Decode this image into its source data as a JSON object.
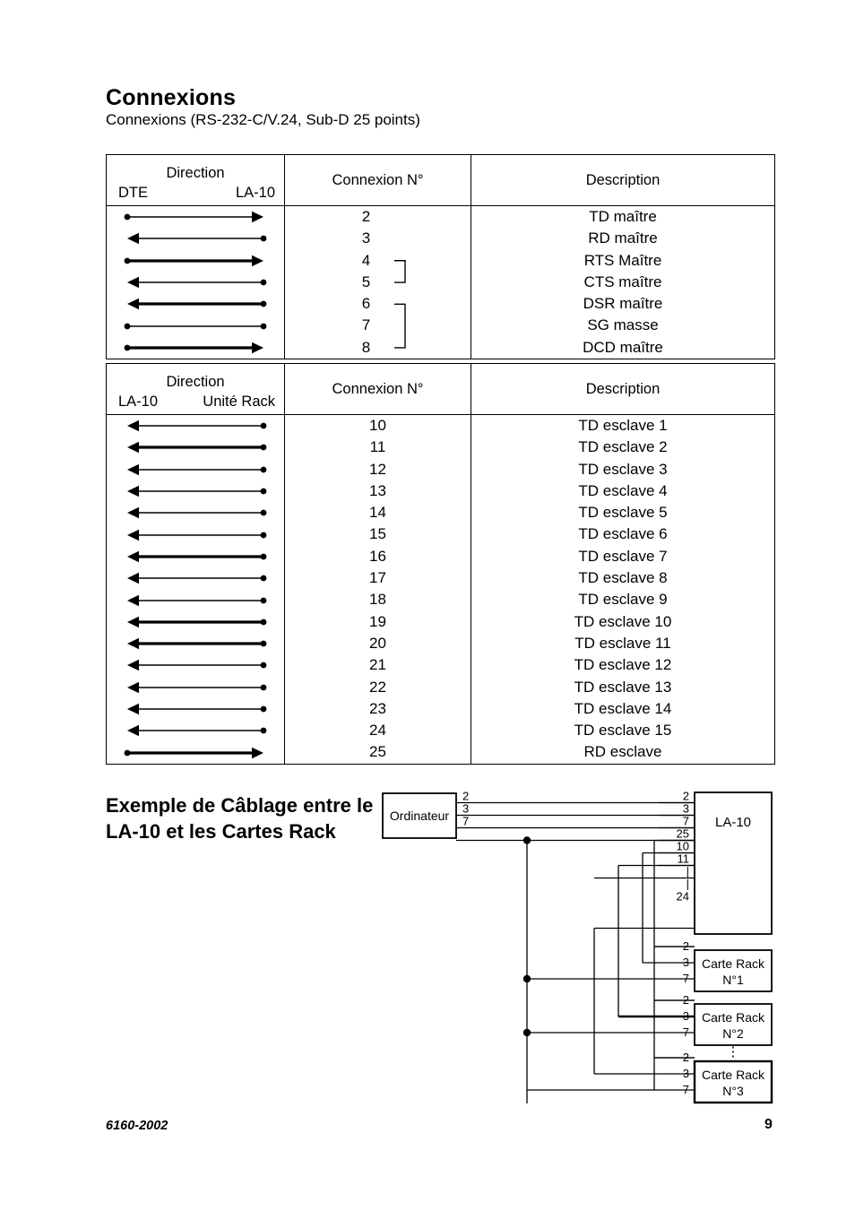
{
  "page": {
    "title": "Connexions",
    "subtitle": "Connexions (RS-232-C/V.24, Sub-D 25 points)"
  },
  "table_dte": {
    "header": {
      "direction": "Direction",
      "from": "DTE",
      "to": "LA-10",
      "connexion": "Connexion N°",
      "description": "Description"
    },
    "rows": [
      {
        "arrow": "right",
        "weight": "thin",
        "num": "2",
        "desc": "TD maître"
      },
      {
        "arrow": "left",
        "weight": "thin",
        "num": "3",
        "desc": "RD maître"
      },
      {
        "arrow": "right",
        "weight": "thick",
        "num": "4",
        "desc": "RTS Maître"
      },
      {
        "arrow": "left",
        "weight": "thin",
        "num": "5",
        "desc": "CTS maître"
      },
      {
        "arrow": "left",
        "weight": "thick",
        "num": "6",
        "desc": "DSR maître"
      },
      {
        "arrow": "none",
        "weight": "thin",
        "num": "7",
        "desc": "SG masse"
      },
      {
        "arrow": "right",
        "weight": "thick",
        "num": "8",
        "desc": "DCD maître"
      }
    ],
    "brackets": [
      {
        "from_row": 2,
        "to_row": 3
      },
      {
        "from_row": 4,
        "to_row": 6
      }
    ]
  },
  "table_rack": {
    "header": {
      "direction": "Direction",
      "from": "LA-10",
      "to": "Unité Rack",
      "connexion": "Connexion N°",
      "description": "Description"
    },
    "rows": [
      {
        "arrow": "left",
        "weight": "thin",
        "num": "10",
        "desc": "TD esclave 1"
      },
      {
        "arrow": "left",
        "weight": "thick",
        "num": "11",
        "desc": "TD esclave 2"
      },
      {
        "arrow": "left",
        "weight": "thin",
        "num": "12",
        "desc": "TD esclave 3"
      },
      {
        "arrow": "left",
        "weight": "thin",
        "num": "13",
        "desc": "TD esclave 4"
      },
      {
        "arrow": "left",
        "weight": "thin",
        "num": "14",
        "desc": "TD esclave 5"
      },
      {
        "arrow": "left",
        "weight": "thin",
        "num": "15",
        "desc": "TD esclave 6"
      },
      {
        "arrow": "left",
        "weight": "thick",
        "num": "16",
        "desc": "TD esclave 7"
      },
      {
        "arrow": "left",
        "weight": "thin",
        "num": "17",
        "desc": "TD esclave 8"
      },
      {
        "arrow": "left",
        "weight": "thin",
        "num": "18",
        "desc": "TD esclave 9"
      },
      {
        "arrow": "left",
        "weight": "thick",
        "num": "19",
        "desc": "TD esclave 10"
      },
      {
        "arrow": "left",
        "weight": "thick",
        "num": "20",
        "desc": "TD esclave 11"
      },
      {
        "arrow": "left",
        "weight": "thin",
        "num": "21",
        "desc": "TD esclave 12"
      },
      {
        "arrow": "left",
        "weight": "thin",
        "num": "22",
        "desc": "TD esclave 13"
      },
      {
        "arrow": "left",
        "weight": "thin",
        "num": "23",
        "desc": "TD esclave 14"
      },
      {
        "arrow": "left",
        "weight": "thin",
        "num": "24",
        "desc": "TD esclave 15"
      },
      {
        "arrow": "right",
        "weight": "thick",
        "num": "25",
        "desc": "RD esclave"
      }
    ]
  },
  "example": {
    "heading": "Exemple de Câblage entre le LA-10 et les Cartes Rack",
    "diagram": {
      "computer": {
        "label": "Ordinateur",
        "pins": [
          "2",
          "3",
          "7"
        ]
      },
      "la10": {
        "label": "LA-10",
        "pins": [
          "2",
          "3",
          "7",
          "25",
          "10",
          "11",
          "|",
          "|",
          "24"
        ]
      },
      "racks": [
        {
          "label_line1": "Carte Rack",
          "label_line2": "N°1",
          "pins": [
            "2",
            "3",
            "7"
          ]
        },
        {
          "label_line1": "Carte Rack",
          "label_line2": "N°2",
          "pins": [
            "2",
            "3",
            "7"
          ]
        },
        {
          "label_line1": "Carte Rack",
          "label_line2": "N°3",
          "pins": [
            "2",
            "3",
            "7"
          ]
        }
      ],
      "ellipsis": "⋮"
    }
  },
  "footer": {
    "code": "6160-2002",
    "page_number": "9"
  },
  "colors": {
    "ink": "#000000",
    "paper": "#ffffff"
  }
}
